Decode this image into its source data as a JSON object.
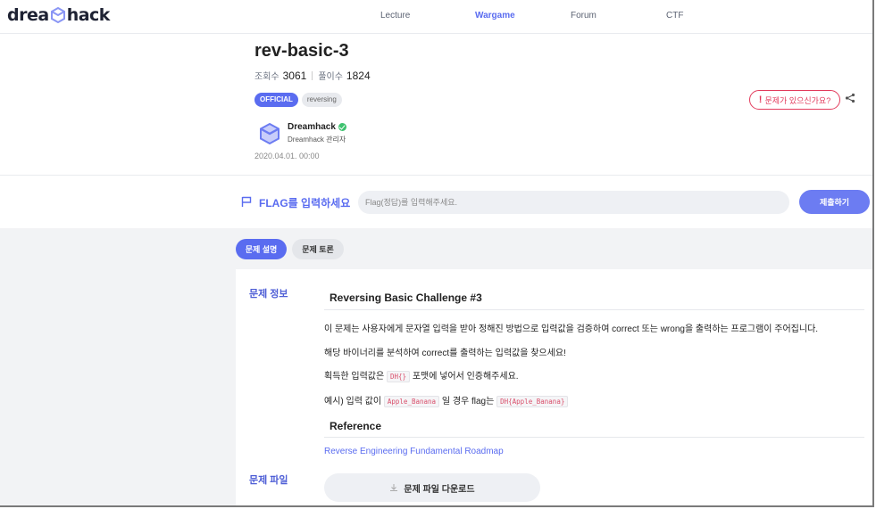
{
  "nav": {
    "logo": {
      "left": "drea",
      "right": "hack"
    },
    "links": [
      "Lecture",
      "Wargame",
      "Forum",
      "CTF"
    ],
    "active": "Wargame"
  },
  "challenge": {
    "title": "rev-basic-3",
    "views_label": "조회수",
    "views": "3061",
    "solves_label": "풀이수",
    "solves": "1824",
    "tags": [
      "OFFICIAL",
      "reversing"
    ],
    "report_label": "문제가 있으신가요?",
    "author_name": "Dreamhack",
    "author_role": "Dreamhack 관리자",
    "date": "2020.04.01. 00:00"
  },
  "flag": {
    "label": "FLAG를 입력하세요",
    "placeholder": "Flag(정답)를 입력해주세요.",
    "value": "",
    "submit": "제출하기"
  },
  "tabs": [
    "문제 설명",
    "문제 토론"
  ],
  "description": {
    "section_label": "문제 정보",
    "title": "Reversing Basic Challenge #3",
    "p1": "이 문제는 사용자에게 문자열 입력을 받아 정해진 방법으로 입력값을 검증하여 correct 또는 wrong을 출력하는 프로그램이 주어집니다.",
    "p2": "해당 바이너리를 분석하여 correct를 출력하는 입력값을 찾으세요!",
    "p3_before": "획득한 입력값은",
    "p3_code": "DH{}",
    "p3_after": "포맷에 넣어서 인증해주세요.",
    "p4_before": "예시) 입력 값이",
    "p4_code1": "Apple_Banana",
    "p4_middle": "일 경우 flag는",
    "p4_code2": "DH{Apple_Banana}",
    "reference_title": "Reference",
    "reference_link": "Reverse Engineering Fundamental Roadmap"
  },
  "files": {
    "section_label": "문제 파일",
    "download_label": "문제 파일 다운로드"
  },
  "colors": {
    "accent": "#5a6cf0",
    "danger": "#e23b5c",
    "code": "#d94f6b"
  }
}
